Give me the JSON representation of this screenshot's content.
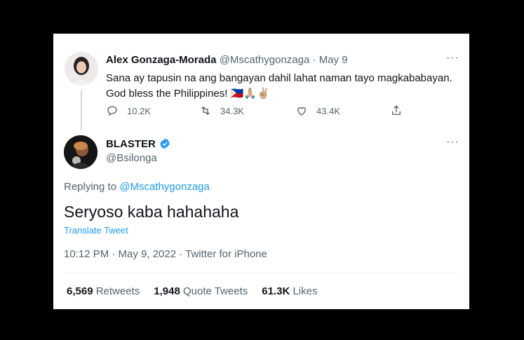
{
  "original_tweet": {
    "author_name": "Alex Gonzaga-Morada",
    "handle": "@Mscathygonzaga",
    "dot": "·",
    "date": "May 9",
    "text_line1": "Sana ay tapusin na ang bangayan dahil lahat naman tayo magkababayan.",
    "text_line2": "God bless the Philippines!",
    "emoji": "🇵🇭🙏🏼✌🏼",
    "reply_count": "10.2K",
    "retweet_count": "34.3K",
    "like_count": "43.4K",
    "more": "···"
  },
  "reply_tweet": {
    "author_name": "BLASTER",
    "handle": "@Bsilonga",
    "more": "···",
    "replying_prefix": "Replying to",
    "replying_handle": "@Mscathygonzaga",
    "text": "Seryoso kaba hahahaha",
    "translate": "Translate Tweet",
    "meta": "10:12 PM · May 9, 2022 · Twitter for iPhone",
    "retweets_count": "6,569",
    "retweets_label": "Retweets",
    "quotes_count": "1,948",
    "quotes_label": "Quote Tweets",
    "likes_count": "61.3K",
    "likes_label": "Likes"
  },
  "colors": {
    "accent": "#1d9bf0",
    "muted": "#536471",
    "text": "#0f1419",
    "background": "#000000"
  }
}
